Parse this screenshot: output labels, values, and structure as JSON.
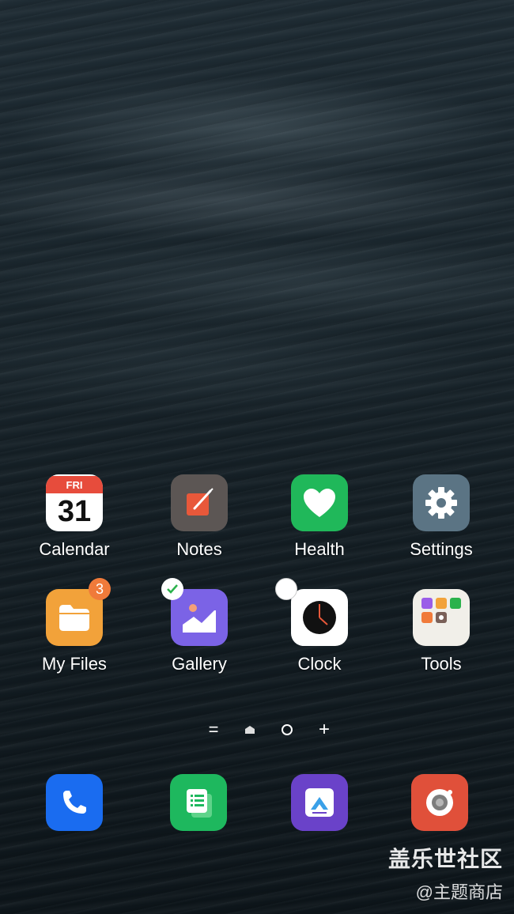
{
  "home_screen": {
    "apps": [
      {
        "label": "Calendar",
        "icon": "calendar-icon",
        "day": "FRI",
        "date": "31"
      },
      {
        "label": "Notes",
        "icon": "notes-icon"
      },
      {
        "label": "Health",
        "icon": "heart-icon"
      },
      {
        "label": "Settings",
        "icon": "gear-icon"
      },
      {
        "label": "My Files",
        "icon": "folder-icon",
        "badge": "3"
      },
      {
        "label": "Gallery",
        "icon": "gallery-icon"
      },
      {
        "label": "Clock",
        "icon": "clock-icon"
      },
      {
        "label": "Tools",
        "icon": "folder-grid-icon"
      }
    ]
  },
  "page_indicator": {
    "menu": "=",
    "add": "+"
  },
  "dock": [
    {
      "icon": "phone-icon"
    },
    {
      "icon": "messages-icon"
    },
    {
      "icon": "app-store-icon"
    },
    {
      "icon": "camera-icon"
    }
  ],
  "watermark": {
    "title": "盖乐世社区",
    "subtitle": "@主题商店"
  },
  "colors": {
    "calendar_red": "#e74c3c",
    "health_green": "#20b85a",
    "files_orange": "#f2a23a",
    "gallery_purple": "#7b63e6",
    "phone_blue": "#1a6cf0",
    "camera_red": "#e0503a"
  }
}
